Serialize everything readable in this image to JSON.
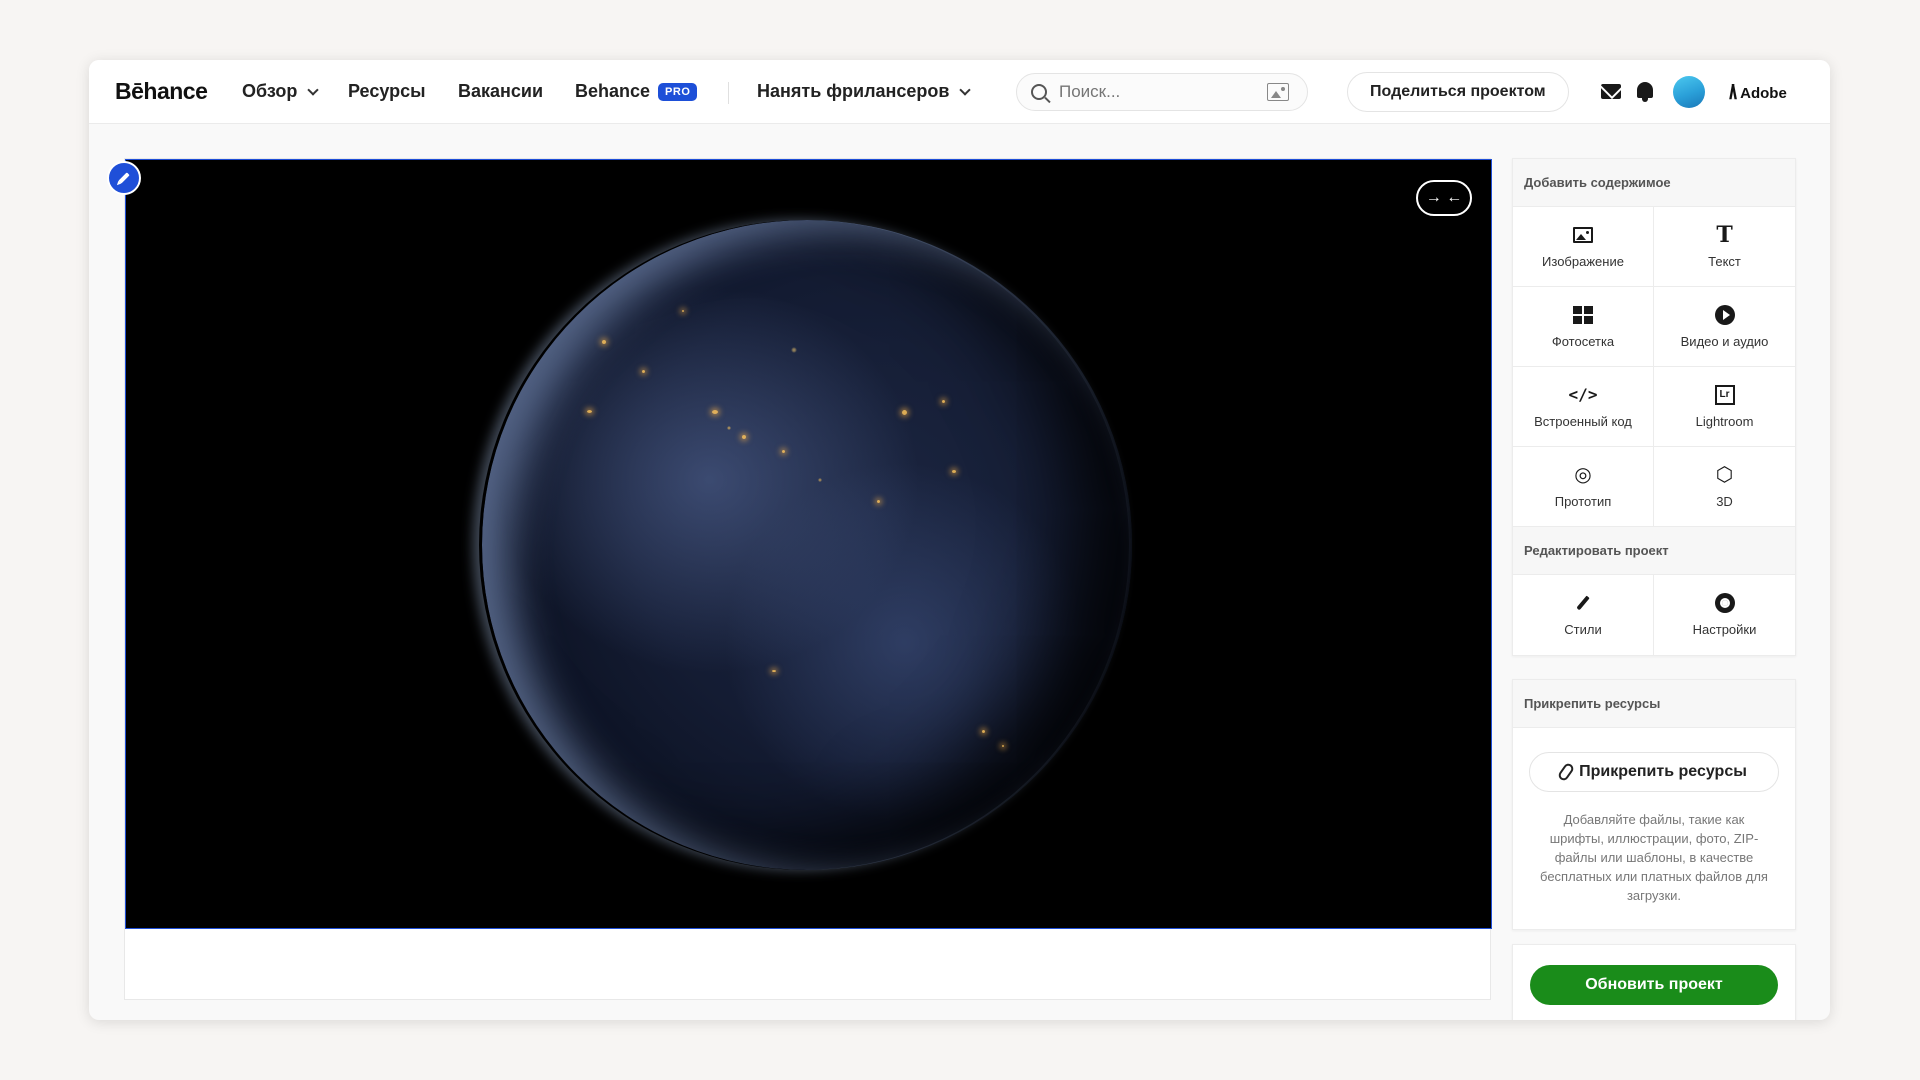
{
  "brand": {
    "logo": "Bēhance"
  },
  "nav": {
    "browse": "Обзор",
    "resources": "Ресурсы",
    "jobs": "Вакансии",
    "behance_pro": "Behance",
    "pro_badge": "PRO",
    "hire": "Нанять фрилансеров"
  },
  "search": {
    "placeholder": "Поиск..."
  },
  "header": {
    "share_label": "Поделиться проектом",
    "adobe_label": "Adobe",
    "adobe_logo": "/\\"
  },
  "media": {
    "collapse_label": "→ ←"
  },
  "add_content": {
    "title": "Добавить содержимое",
    "items": [
      {
        "label": "Изображение",
        "icon": "image-icon"
      },
      {
        "label": "Текст",
        "icon": "text-icon",
        "glyph": "T"
      },
      {
        "label": "Фотосетка",
        "icon": "photo-grid-icon"
      },
      {
        "label": "Видео и аудио",
        "icon": "play-icon"
      },
      {
        "label": "Встроенный код",
        "icon": "code-icon",
        "glyph": "</>"
      },
      {
        "label": "Lightroom",
        "icon": "lightroom-icon",
        "glyph": "Lr"
      },
      {
        "label": "Прототип",
        "icon": "prototype-icon",
        "glyph": "◎"
      },
      {
        "label": "3D",
        "icon": "cube-icon",
        "glyph": "⬡"
      }
    ]
  },
  "edit_project": {
    "title": "Редактировать проект",
    "items": [
      {
        "label": "Стили",
        "icon": "brush-icon"
      },
      {
        "label": "Настройки",
        "icon": "gear-icon"
      }
    ]
  },
  "attach": {
    "title": "Прикрепить ресурсы",
    "button_label": "Прикрепить ресурсы",
    "description": "Добавляйте файлы, такие как шрифты, иллюстрации, фото, ZIP-файлы или шаблоны, в качестве бесплатных или платных файлов для загрузки."
  },
  "update": {
    "button_label": "Обновить проект"
  },
  "colors": {
    "accent": "#1f4fd8",
    "success": "#1a8c1a"
  }
}
